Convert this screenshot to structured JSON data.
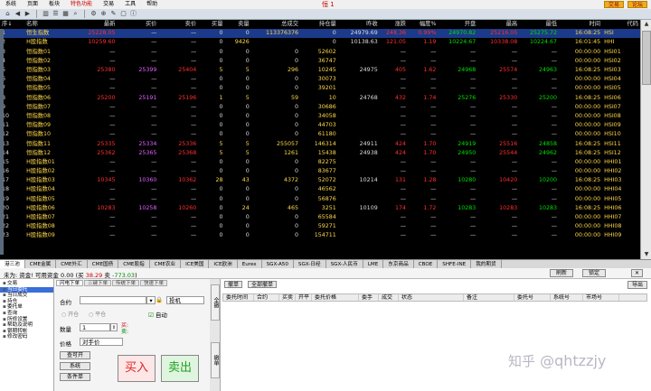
{
  "menu": {
    "items": [
      "系统",
      "页面",
      "板块",
      "特色功能",
      "交易",
      "工具",
      "帮助"
    ],
    "window_title": "恒 1",
    "trade_button": "交易",
    "forum_button": "论坛"
  },
  "toolbar_icons": [
    "home-icon",
    "back-icon",
    "forward-icon",
    "chart-icon",
    "list-icon",
    "grid-icon",
    "search-icon",
    "settings-icon",
    "zoom-icon",
    "tool-icon",
    "window-icon",
    "info-icon"
  ],
  "grid": {
    "headers": [
      "序↓",
      "名称",
      "最新",
      "买价",
      "卖价",
      "买量",
      "卖量",
      "总成交",
      "持仓量",
      "昨收",
      "涨跌",
      "幅度%",
      "开盘",
      "最高",
      "最低",
      "时间",
      "代码"
    ],
    "rows": [
      {
        "n": "1",
        "name": "恒生指数",
        "last": "25228.05",
        "bid": "—",
        "ask": "—",
        "bq": "0",
        "aq": "0",
        "vol": "113376376",
        "oi": "0",
        "pc": "24979.69",
        "chg": "248.36",
        "pct": "0.99%",
        "open": "24970.82",
        "high": "25216.05",
        "low": "25275.72",
        "time": "16:08:25",
        "code": "HSI",
        "hl": true
      },
      {
        "n": "2",
        "name": "H股指数",
        "last": "10259.60",
        "bid": "—",
        "ask": "—",
        "bq": "0",
        "aq": "9426",
        "vol": "",
        "oi": "0",
        "pc": "10138.63",
        "chg": "121.05",
        "pct": "1.19",
        "open": "10224.67",
        "high": "10338.08",
        "low": "10224.67",
        "time": "16:01:45",
        "code": "HHI"
      },
      {
        "n": "3",
        "name": "恒指数01",
        "last": "—",
        "bid": "—",
        "ask": "—",
        "bq": "0",
        "aq": "0",
        "vol": "0",
        "oi": "52602",
        "pc": "",
        "chg": "—",
        "pct": "—",
        "open": "—",
        "high": "—",
        "low": "—",
        "time": "00:00:00",
        "code": "HSI01"
      },
      {
        "n": "4",
        "name": "恒指数02",
        "last": "—",
        "bid": "—",
        "ask": "—",
        "bq": "0",
        "aq": "0",
        "vol": "0",
        "oi": "36747",
        "pc": "",
        "chg": "—",
        "pct": "—",
        "open": "—",
        "high": "—",
        "low": "—",
        "time": "00:00:00",
        "code": "HSI02"
      },
      {
        "n": "5",
        "name": "恒指数03",
        "last": "25380",
        "bid": "25399",
        "ask": "25404",
        "bq": "5",
        "aq": "5",
        "vol": "296",
        "oi": "10245",
        "pc": "24975",
        "chg": "405",
        "pct": "1.62",
        "open": "24968",
        "high": "25574",
        "low": "24963",
        "time": "16:08:25",
        "code": "HSI03"
      },
      {
        "n": "6",
        "name": "恒指数04",
        "last": "—",
        "bid": "—",
        "ask": "—",
        "bq": "0",
        "aq": "0",
        "vol": "0",
        "oi": "30073",
        "pc": "",
        "chg": "—",
        "pct": "—",
        "open": "—",
        "high": "—",
        "low": "—",
        "time": "00:00:00",
        "code": "HSI04"
      },
      {
        "n": "7",
        "name": "恒指数05",
        "last": "—",
        "bid": "—",
        "ask": "—",
        "bq": "0",
        "aq": "0",
        "vol": "0",
        "oi": "39201",
        "pc": "",
        "chg": "—",
        "pct": "—",
        "open": "—",
        "high": "—",
        "low": "—",
        "time": "00:00:00",
        "code": "HSI05"
      },
      {
        "n": "8",
        "name": "恒指数06",
        "last": "25200",
        "bid": "25191",
        "ask": "25196",
        "bq": "1",
        "aq": "5",
        "vol": "59",
        "oi": "10",
        "pc": "24768",
        "chg": "432",
        "pct": "1.74",
        "open": "25276",
        "high": "25330",
        "low": "25200",
        "time": "16:08:25",
        "code": "HSI06"
      },
      {
        "n": "9",
        "name": "恒指数07",
        "last": "—",
        "bid": "—",
        "ask": "—",
        "bq": "0",
        "aq": "0",
        "vol": "0",
        "oi": "30686",
        "pc": "",
        "chg": "—",
        "pct": "—",
        "open": "—",
        "high": "—",
        "low": "—",
        "time": "00:00:00",
        "code": "HSI07"
      },
      {
        "n": "10",
        "name": "恒指数08",
        "last": "—",
        "bid": "—",
        "ask": "—",
        "bq": "0",
        "aq": "0",
        "vol": "0",
        "oi": "34058",
        "pc": "",
        "chg": "—",
        "pct": "—",
        "open": "—",
        "high": "—",
        "low": "—",
        "time": "00:00:00",
        "code": "HSI08"
      },
      {
        "n": "11",
        "name": "恒指数09",
        "last": "—",
        "bid": "—",
        "ask": "—",
        "bq": "0",
        "aq": "0",
        "vol": "0",
        "oi": "44703",
        "pc": "",
        "chg": "—",
        "pct": "—",
        "open": "—",
        "high": "—",
        "low": "—",
        "time": "00:00:00",
        "code": "HSI09"
      },
      {
        "n": "12",
        "name": "恒指数10",
        "last": "—",
        "bid": "—",
        "ask": "—",
        "bq": "0",
        "aq": "0",
        "vol": "0",
        "oi": "61180",
        "pc": "",
        "chg": "—",
        "pct": "—",
        "open": "—",
        "high": "—",
        "low": "—",
        "time": "00:00:00",
        "code": "HSI10"
      },
      {
        "n": "13",
        "name": "恒指数11",
        "last": "25335",
        "bid": "25334",
        "ask": "25336",
        "bq": "5",
        "aq": "5",
        "vol": "255057",
        "oi": "146314",
        "pc": "24911",
        "chg": "424",
        "pct": "1.70",
        "open": "24919",
        "high": "25516",
        "low": "24858",
        "time": "16:08:25",
        "code": "HSI11"
      },
      {
        "n": "14",
        "name": "恒指数12",
        "last": "25362",
        "bid": "25365",
        "ask": "25368",
        "bq": "5",
        "aq": "5",
        "vol": "1261",
        "oi": "15438",
        "pc": "24938",
        "chg": "424",
        "pct": "1.70",
        "open": "24950",
        "high": "25544",
        "low": "24962",
        "time": "16:08:25",
        "code": "HSI12"
      },
      {
        "n": "15",
        "name": "H股指数01",
        "last": "—",
        "bid": "—",
        "ask": "—",
        "bq": "0",
        "aq": "0",
        "vol": "0",
        "oi": "82275",
        "pc": "",
        "chg": "—",
        "pct": "—",
        "open": "—",
        "high": "—",
        "low": "—",
        "time": "00:00:00",
        "code": "HHI01"
      },
      {
        "n": "16",
        "name": "H股指数02",
        "last": "—",
        "bid": "—",
        "ask": "—",
        "bq": "0",
        "aq": "0",
        "vol": "0",
        "oi": "83677",
        "pc": "",
        "chg": "—",
        "pct": "—",
        "open": "—",
        "high": "—",
        "low": "—",
        "time": "00:00:00",
        "code": "HHI02"
      },
      {
        "n": "17",
        "name": "H股指数03",
        "last": "10345",
        "bid": "10360",
        "ask": "10362",
        "bq": "28",
        "aq": "43",
        "vol": "4372",
        "oi": "52072",
        "pc": "10214",
        "chg": "131",
        "pct": "1.28",
        "open": "10280",
        "high": "10420",
        "low": "10200",
        "time": "16:08:25",
        "code": "HHI03"
      },
      {
        "n": "18",
        "name": "H股指数04",
        "last": "—",
        "bid": "—",
        "ask": "—",
        "bq": "0",
        "aq": "0",
        "vol": "0",
        "oi": "46562",
        "pc": "",
        "chg": "—",
        "pct": "—",
        "open": "—",
        "high": "—",
        "low": "—",
        "time": "00:00:00",
        "code": "HHI04"
      },
      {
        "n": "19",
        "name": "H股指数05",
        "last": "—",
        "bid": "—",
        "ask": "—",
        "bq": "0",
        "aq": "0",
        "vol": "0",
        "oi": "56876",
        "pc": "",
        "chg": "—",
        "pct": "—",
        "open": "—",
        "high": "—",
        "low": "—",
        "time": "00:00:00",
        "code": "HHI05"
      },
      {
        "n": "20",
        "name": "H股指数06",
        "last": "10283",
        "bid": "10258",
        "ask": "10260",
        "bq": "0",
        "aq": "24",
        "vol": "465",
        "oi": "3251",
        "pc": "10109",
        "chg": "174",
        "pct": "1.72",
        "open": "10283",
        "high": "10283",
        "low": "10283",
        "time": "16:08:25",
        "code": "HHI06"
      },
      {
        "n": "21",
        "name": "H股指数07",
        "last": "—",
        "bid": "—",
        "ask": "—",
        "bq": "0",
        "aq": "0",
        "vol": "0",
        "oi": "65584",
        "pc": "",
        "chg": "—",
        "pct": "—",
        "open": "—",
        "high": "—",
        "low": "—",
        "time": "00:00:00",
        "code": "HHI07"
      },
      {
        "n": "22",
        "name": "H股指数08",
        "last": "—",
        "bid": "—",
        "ask": "—",
        "bq": "0",
        "aq": "0",
        "vol": "0",
        "oi": "59271",
        "pc": "",
        "chg": "—",
        "pct": "—",
        "open": "—",
        "high": "—",
        "low": "—",
        "time": "00:00:00",
        "code": "HHI08"
      },
      {
        "n": "23",
        "name": "H股指数09",
        "last": "—",
        "bid": "—",
        "ask": "—",
        "bq": "0",
        "aq": "0",
        "vol": "0",
        "oi": "154711",
        "pc": "",
        "chg": "—",
        "pct": "—",
        "open": "—",
        "high": "—",
        "low": "—",
        "time": "00:00:00",
        "code": "HHI09"
      }
    ]
  },
  "tabs": [
    "港三池",
    "CME金属",
    "CME外汇",
    "CME国债",
    "CME股指",
    "CME农业",
    "ICE美国",
    "ICE欧洲",
    "Eurex",
    "SGX-A50",
    "SGX-日经",
    "SGX-人民币",
    "LME",
    "东京商品",
    "CBOE",
    "SHFE-INE",
    "我的期货"
  ],
  "status": {
    "prefix": "未为: 资金! 可用资金",
    "amount": "0.00",
    "paren_open": "(买",
    "buy_val": "38.29",
    "sell_label": "卖",
    "sell_val": "-773.03",
    "paren_close": ")",
    "refresh": "刷新",
    "lock": "锁定",
    "close": "关闭"
  },
  "tree": [
    "交易",
    "当日委托",
    "当日成交",
    "持仓",
    "委托单",
    "查询",
    "所修设置",
    "帮助及说明",
    "银期转帐",
    "修改密码"
  ],
  "order_form": {
    "tabs": [
      "闪电下单",
      "三键下单",
      "传统下单",
      "快速下单"
    ],
    "contract_label": "合约",
    "contract_value": "",
    "direction": "投机",
    "open_radio": "开仓",
    "close_radio": "平仓",
    "auto_label": "自动",
    "qty_label": "数量",
    "qty_value": "1",
    "buy_hint": "买:",
    "sell_hint": "卖:",
    "price_label": "价格",
    "price_value": "对手价",
    "btn_available": "查可开",
    "btn_market": "系统",
    "btn_condition": "条件单",
    "buy": "买入",
    "sell": "卖出"
  },
  "side_buttons": [
    "全撤",
    "撤单"
  ],
  "orders_panel": {
    "top_buttons": [
      "撤单",
      "全部撤单"
    ],
    "export": "导出",
    "headers": [
      "委托时间",
      "合约",
      "买卖",
      "开平",
      "委托价格",
      "委手",
      "成交",
      "状态",
      "备注",
      "委托号",
      "系统号",
      "市场号"
    ],
    "watermark_zh": "知乎",
    "watermark_handle": "@qhtzzjy"
  }
}
